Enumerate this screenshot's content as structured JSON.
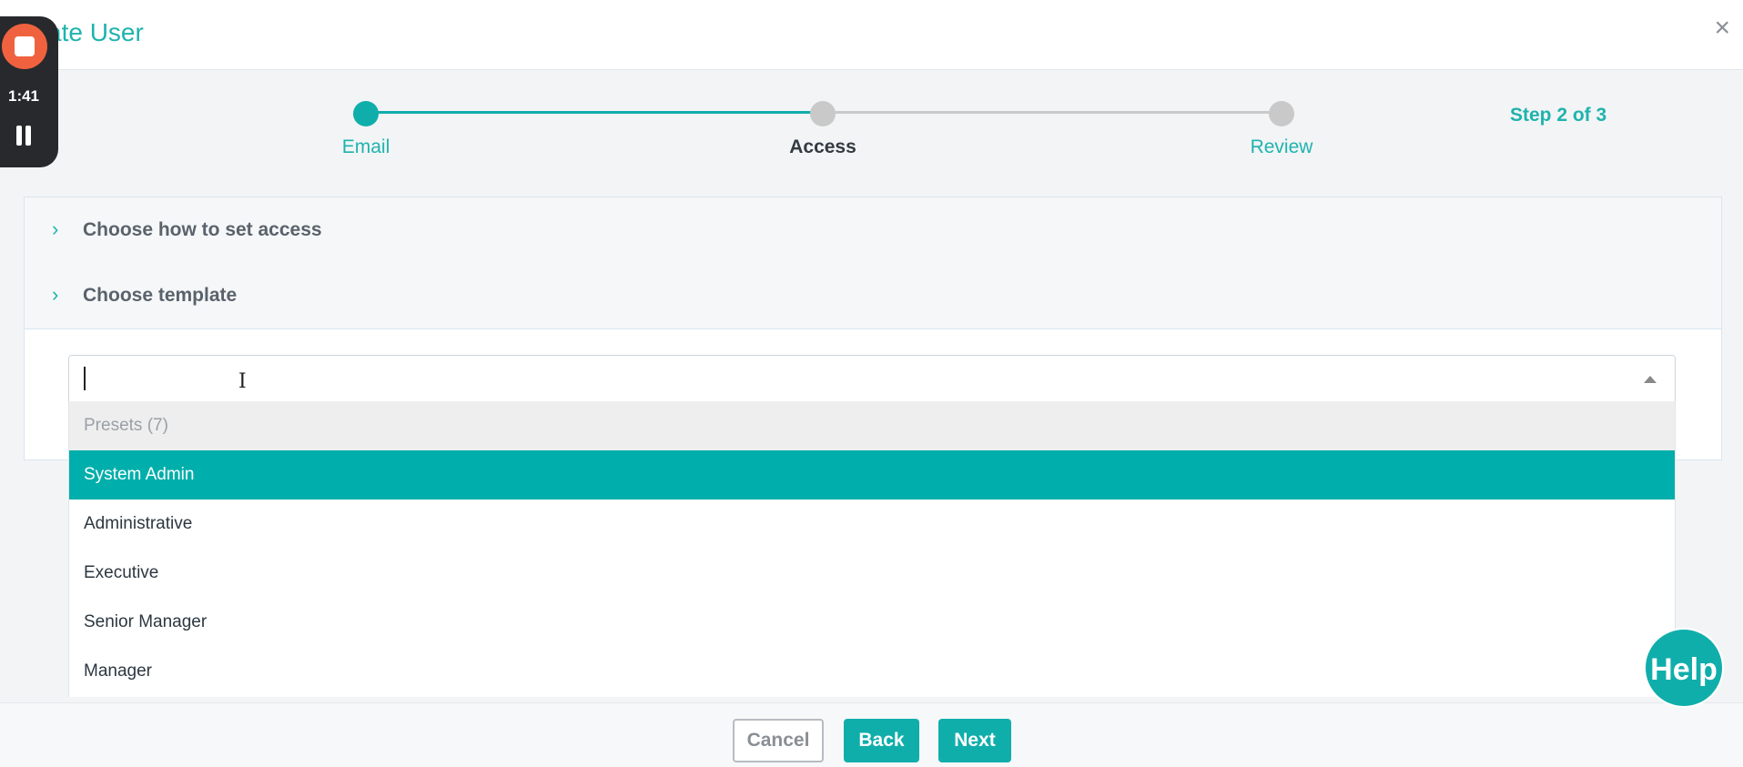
{
  "dialog": {
    "title": "ate User",
    "close_symbol": "×"
  },
  "recorder": {
    "time": "1:41",
    "stop_icon": "stop-icon",
    "pause_icon": "pause-icon"
  },
  "stepper": {
    "steps": [
      {
        "label": "Email",
        "state": "completed"
      },
      {
        "label": "Access",
        "state": "current"
      },
      {
        "label": "Review",
        "state": "upcoming"
      }
    ],
    "count_label": "Step 2 of 3"
  },
  "accordion": {
    "sections": [
      {
        "label": "Choose how to set access",
        "chevron": "›"
      },
      {
        "label": "Choose template",
        "chevron": "›"
      }
    ]
  },
  "template_select": {
    "value": "",
    "group_label": "Presets (7)",
    "options": [
      {
        "label": "System Admin",
        "highlighted": true
      },
      {
        "label": "Administrative",
        "highlighted": false
      },
      {
        "label": "Executive",
        "highlighted": false
      },
      {
        "label": "Senior Manager",
        "highlighted": false
      },
      {
        "label": "Manager",
        "highlighted": false
      }
    ]
  },
  "help_button": {
    "label": "Help"
  },
  "footer": {
    "cancel_label": "Cancel",
    "back_label": "Back",
    "next_label": "Next"
  },
  "colors": {
    "accent": "#10aeab",
    "recorder_stop": "#f0623f",
    "inactive_step": "#c9c9c9"
  }
}
